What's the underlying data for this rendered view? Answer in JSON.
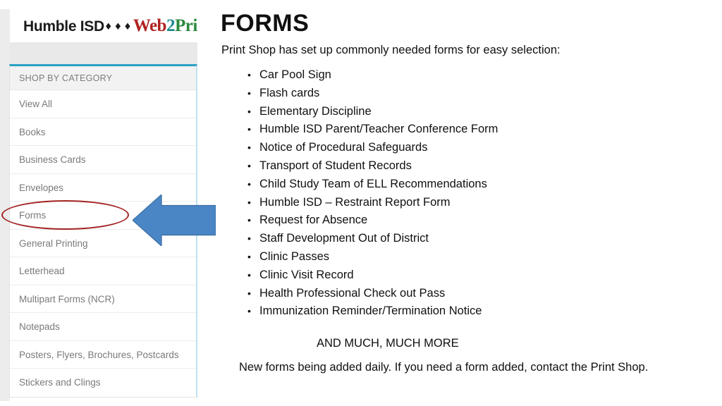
{
  "screenshot_panel": {
    "logo": {
      "brand_left": "Humble ISD",
      "diamonds": "♦♦♦",
      "brand_right_part1": "Web",
      "brand_right_part2": "2",
      "brand_right_part3": "Pri",
      "colors": {
        "web": "#b02222",
        "two": "#1b8a8a",
        "print": "#2a8a3c",
        "humble": "#1a1a1a"
      }
    },
    "sidebar": {
      "header": "SHOP BY CATEGORY",
      "items": [
        {
          "label": "View All"
        },
        {
          "label": "Books"
        },
        {
          "label": "Business Cards"
        },
        {
          "label": "Envelopes"
        },
        {
          "label": "Forms"
        },
        {
          "label": "General Printing"
        },
        {
          "label": "Letterhead"
        },
        {
          "label": "Multipart Forms (NCR)"
        },
        {
          "label": "Notepads"
        },
        {
          "label": "Posters, Flyers, Brochures, Postcards"
        },
        {
          "label": "Stickers and Clings"
        }
      ],
      "accent_top_border": "#2b9fc4",
      "right_border": "#bfe2f0"
    },
    "annotations": {
      "highlight_ellipse": {
        "target": "Forms",
        "color": "#a32222"
      },
      "pointer_arrow": {
        "direction": "left",
        "color": "#4a86c5",
        "target": "Forms"
      }
    }
  },
  "content": {
    "title": "FORMS",
    "subtitle": "Print Shop has set up commonly needed forms for easy selection:",
    "bullet_char": "•",
    "bullets": [
      "Car Pool Sign",
      "Flash cards",
      "Elementary Discipline",
      "Humble ISD Parent/Teacher Conference Form",
      "Notice of Procedural Safeguards",
      "Transport of Student Records",
      "Child Study Team of ELL Recommendations",
      "Humble ISD – Restraint Report Form",
      "Request for Absence",
      "Staff Development Out of District",
      "Clinic Passes",
      "Clinic Visit Record",
      "Health Professional Check out Pass",
      "Immunization Reminder/Termination Notice"
    ],
    "and_more": "AND MUCH, MUCH MORE",
    "closing": "New forms being added daily.  If you need a form added, contact the Print Shop."
  }
}
